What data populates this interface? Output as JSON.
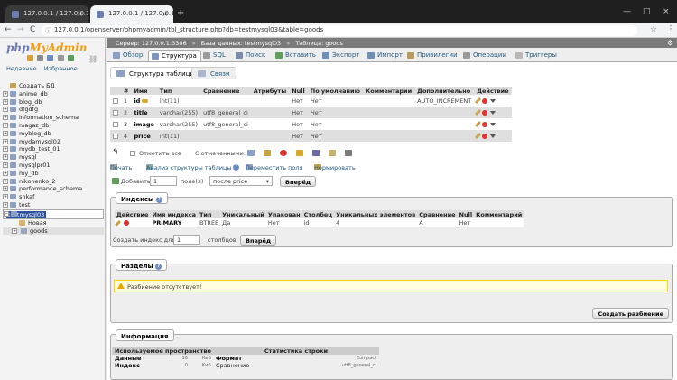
{
  "browser": {
    "tabs": [
      {
        "title": "127.0.0.1 / 127.0.0.1 / te"
      },
      {
        "title": "127.0.0.1 / 127.0.0.1 / te"
      }
    ],
    "url": "127.0.0.1/openserver/phpmyadmin/tbl_structure.php?db=testmysql03&table=goods",
    "nav": {
      "back": "←",
      "forward": "→",
      "reload": "C",
      "info": "ⓘ",
      "star": "☆",
      "menu": "⋮",
      "close": "×",
      "newtab": "+",
      "minimize": "—",
      "maximize": "□"
    }
  },
  "sidebar": {
    "logo_php": "php",
    "logo_myadmin": "MyAdmin",
    "links": {
      "recent": "Недавние",
      "favorites": "Избранное"
    },
    "link_icon": "⛓",
    "tree": [
      {
        "label": "Создать БД",
        "exp": "",
        "kind": "new"
      },
      {
        "label": "anime_db",
        "exp": "+",
        "kind": "db"
      },
      {
        "label": "blog_db",
        "exp": "+",
        "kind": "db"
      },
      {
        "label": "dfgdfg",
        "exp": "+",
        "kind": "db"
      },
      {
        "label": "information_schema",
        "exp": "+",
        "kind": "db"
      },
      {
        "label": "magaz_db",
        "exp": "+",
        "kind": "db"
      },
      {
        "label": "myblog_db",
        "exp": "+",
        "kind": "db"
      },
      {
        "label": "mydamysql02",
        "exp": "+",
        "kind": "db"
      },
      {
        "label": "mydb_test_01",
        "exp": "+",
        "kind": "db"
      },
      {
        "label": "mysql",
        "exp": "+",
        "kind": "db"
      },
      {
        "label": "mysqlpr01",
        "exp": "+",
        "kind": "db"
      },
      {
        "label": "my_db",
        "exp": "+",
        "kind": "db"
      },
      {
        "label": "nikonenko_2",
        "exp": "+",
        "kind": "db"
      },
      {
        "label": "performance_schema",
        "exp": "+",
        "kind": "db"
      },
      {
        "label": "shkaf",
        "exp": "+",
        "kind": "db"
      },
      {
        "label": "test",
        "exp": "+",
        "kind": "db"
      },
      {
        "label": "testmysql03",
        "exp": "−",
        "kind": "db-selected"
      },
      {
        "label": "Новая",
        "exp": "",
        "kind": "sub"
      },
      {
        "label": "goods",
        "exp": "+",
        "kind": "sub2"
      }
    ]
  },
  "breadcrumb": {
    "server": "Сервер: 127.0.0.1:3306",
    "database": "База данных: testmysql03",
    "table": "Таблица: goods",
    "sep": "»",
    "gear": "⚙"
  },
  "tabs": [
    {
      "label": "Обзор",
      "color": "#8aa0c8"
    },
    {
      "label": "Структура",
      "color": "#7f95bf",
      "active": true
    },
    {
      "label": "SQL",
      "color": "#9b9b9b"
    },
    {
      "label": "Поиск",
      "color": "#7a8ca8"
    },
    {
      "label": "Вставить",
      "color": "#5e9f5b"
    },
    {
      "label": "Экспорт",
      "color": "#6d8fb8"
    },
    {
      "label": "Импорт",
      "color": "#6d8fb8"
    },
    {
      "label": "Привилегии",
      "color": "#b89a5e"
    },
    {
      "label": "Операции",
      "color": "#9a9a9a"
    },
    {
      "label": "Триггеры",
      "color": "#b8b8b8"
    }
  ],
  "subtabs": [
    {
      "label": "Структура таблицы",
      "active": true
    },
    {
      "label": "Связи"
    }
  ],
  "structure": {
    "headers": [
      "#",
      "Имя",
      "Тип",
      "Сравнение",
      "Атрибуты",
      "Null",
      "По умолчанию",
      "Комментарии",
      "Дополнительно",
      "Действие"
    ],
    "rows": [
      {
        "num": "1",
        "name": "id",
        "type": "int(11)",
        "collation": "",
        "attributes": "",
        "null": "Нет",
        "default": "Нет",
        "comments": "",
        "extra": "AUTO_INCREMENT"
      },
      {
        "num": "2",
        "name": "title",
        "type": "varchar(255)",
        "collation": "utf8_general_ci",
        "attributes": "",
        "null": "Нет",
        "default": "Нет",
        "comments": "",
        "extra": ""
      },
      {
        "num": "3",
        "name": "image",
        "type": "varchar(255)",
        "collation": "utf8_general_ci",
        "attributes": "",
        "null": "Нет",
        "default": "Нет",
        "comments": "",
        "extra": ""
      },
      {
        "num": "4",
        "name": "price",
        "type": "int(11)",
        "collation": "",
        "attributes": "",
        "null": "Нет",
        "default": "Нет",
        "comments": "",
        "extra": ""
      }
    ]
  },
  "selection": {
    "arrow": "↰",
    "check_all": "Отметить все",
    "with_selected": "С отмеченными:"
  },
  "tools": {
    "print": "Печать",
    "analyze": "Анализ структуры таблицы",
    "help": "?",
    "move_columns": "Переместить поля",
    "normalize": "Нормировать"
  },
  "add_columns": {
    "label": "Добавить",
    "count": "1",
    "suffix": "поле(я)",
    "position": "после price",
    "dropdown_arrow": "▾",
    "button": "Вперёд"
  },
  "indexes": {
    "legend": "Индексы",
    "headers": [
      "Действие",
      "Имя индекса",
      "Тип",
      "Уникальный",
      "Упакован",
      "Столбец",
      "Уникальных элементов",
      "Сравнение",
      "Null",
      "Комментарий"
    ],
    "rows": [
      {
        "name": "PRIMARY",
        "type": "BTREE",
        "unique": "Да",
        "packed": "Нет",
        "column": "id",
        "cardinality": "4",
        "collation": "A",
        "null": "Нет",
        "comment": ""
      }
    ],
    "create_label": "Создать индекс для",
    "create_count": "1",
    "create_suffix": "столбцов",
    "create_button": "Вперёд"
  },
  "partitions": {
    "legend": "Разделы",
    "notice": "Разбиение отсутствует!",
    "button": "Создать разбиение"
  },
  "information": {
    "legend": "Информация",
    "space_header": "Используемое пространство",
    "stats_header": "Статистика строки",
    "space_rows": [
      {
        "label": "Данные",
        "value": "16",
        "unit": "КиБ"
      },
      {
        "label": "Индекс",
        "value": "0",
        "unit": "КиБ"
      }
    ],
    "stats_rows": [
      {
        "label": "Формат",
        "value": "Compact"
      },
      {
        "label": "Сравнение",
        "value": "utf8_general_ci"
      }
    ]
  }
}
